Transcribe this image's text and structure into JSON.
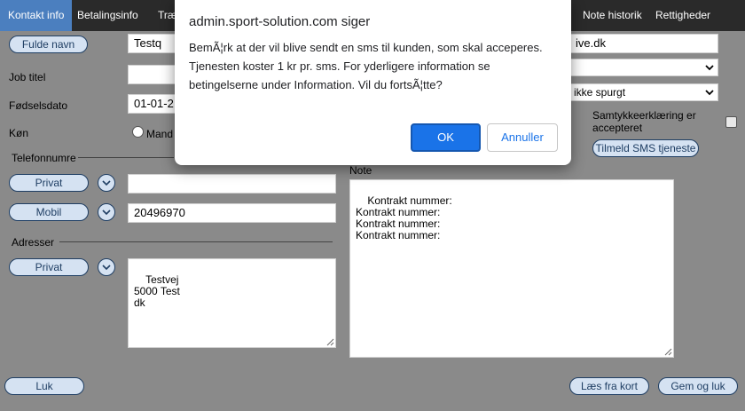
{
  "tabs": [
    {
      "label": "Kontakt info"
    },
    {
      "label": "Betalingsinfo"
    },
    {
      "label": "Træ"
    },
    {
      "label": "Note historik"
    },
    {
      "label": "Rettigheder"
    }
  ],
  "form": {
    "full_name_button": "Fulde navn",
    "full_name_value": "Testq",
    "job_title_label": "Job titel",
    "job_title_value": "",
    "birthdate_label": "Fødselsdato",
    "birthdate_value": "01-01-2",
    "gender_label": "Køn",
    "gender_option_male": "Mand",
    "email_value": "ive.dk",
    "select1_value": "",
    "select2_value": "ikke spurgt",
    "consent_label": "Samtykkeerklæring er accepteret",
    "sms_button": "Tilmeld SMS tjeneste",
    "phone_section_label": "Telefonnumre",
    "phone1_type": "Privat",
    "phone1_value": "",
    "phone2_type": "Mobil",
    "phone2_value": "20496970",
    "address_section_label": "Adresser",
    "address_type": "Privat",
    "address_value": "Testvej\n5000 Test\ndk",
    "note_label": "Note",
    "note_value": "Kontrakt nummer:\nKontrakt nummer:\nKontrakt nummer:\nKontrakt nummer:"
  },
  "footer": {
    "close_button": "Luk",
    "read_card_button": "Læs fra kort",
    "save_close_button": "Gem og luk"
  },
  "dialog": {
    "title": "admin.sport-solution.com siger",
    "message": "BemÃ¦rk at der vil blive sendt en sms til kunden, som skal acceperes. Tjenesten koster 1 kr pr. sms. For yderligere information se betingelserne under Information. Vil du fortsÃ¦tte?",
    "ok_label": "OK",
    "cancel_label": "Annuller"
  },
  "colors": {
    "tabbar": "#2a2a2a",
    "active_tab": "#4b7fbf",
    "ok_button": "#1a73e8",
    "overlay_background": "#8a8a8a"
  }
}
